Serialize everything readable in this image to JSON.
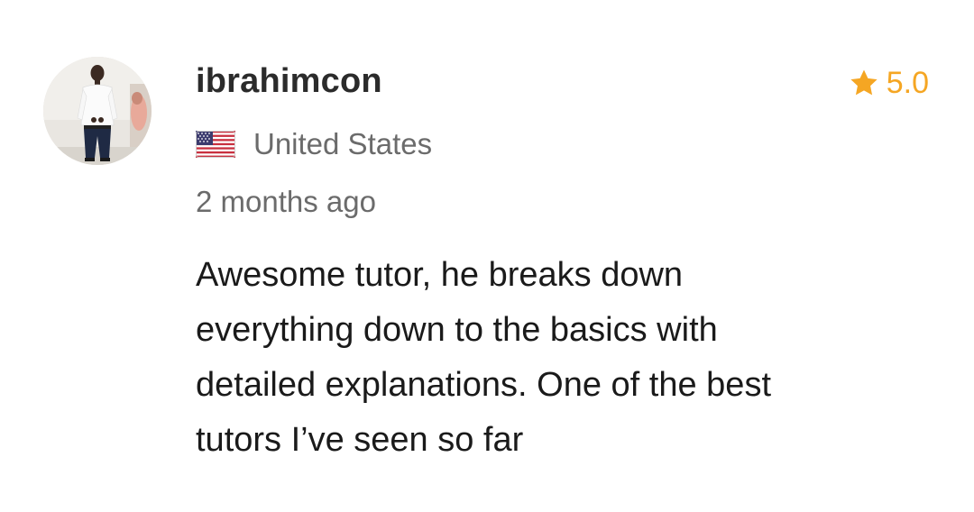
{
  "review": {
    "username": "ibrahimcon",
    "rating": "5.0",
    "country": "United States",
    "flag_icon": "us-flag-icon",
    "time_ago": "2 months ago",
    "text": "Awesome tutor, he breaks down\neverything down to the basics with\ndetailed explanations.  One of the best\ntutors I’ve seen so far"
  },
  "colors": {
    "star": "#f5a623",
    "username": "#2b2b2b",
    "secondary_text": "#6b6b6b",
    "body_text": "#1a1a1a"
  },
  "icons": {
    "rating": "star-icon",
    "country": "us-flag-icon",
    "avatar": "user-avatar"
  }
}
